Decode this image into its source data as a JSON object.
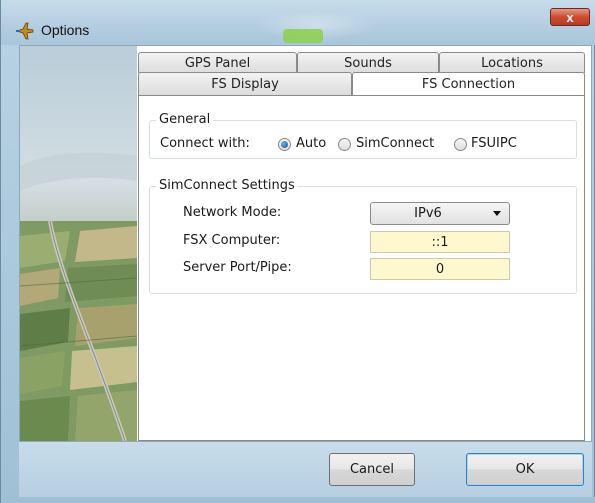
{
  "window": {
    "title": "Options",
    "close_glyph": "x"
  },
  "tabs": {
    "back_row": [
      {
        "label": "GPS Panel"
      },
      {
        "label": "Sounds"
      },
      {
        "label": "Locations"
      }
    ],
    "front_row": [
      {
        "label": "FS Display"
      },
      {
        "label": "FS Connection",
        "selected": true
      }
    ]
  },
  "general": {
    "title": "General",
    "connect_label": "Connect with:",
    "options": [
      {
        "label": "Auto",
        "checked": true
      },
      {
        "label": "SimConnect",
        "checked": false
      },
      {
        "label": "FSUIPC",
        "checked": false
      }
    ]
  },
  "simconnect": {
    "title": "SimConnect Settings",
    "network_mode_label": "Network Mode:",
    "network_mode_value": "IPv6",
    "fsx_computer_label": "FSX Computer:",
    "fsx_computer_value": "::1",
    "server_port_label": "Server Port/Pipe:",
    "server_port_value": "0"
  },
  "buttons": {
    "cancel": "Cancel",
    "ok": "OK"
  },
  "colors": {
    "field_background": "#fff8cf",
    "frame": "#b3cde0",
    "close_button": "#cf4b30"
  },
  "icons": {
    "app": "plane-icon",
    "close": "close-icon",
    "dropdown": "chevron-down-icon"
  }
}
